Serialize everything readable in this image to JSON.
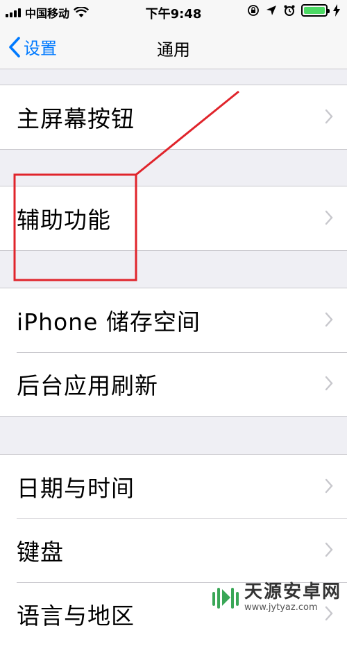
{
  "status_bar": {
    "carrier": "中国移动",
    "time": "下午9:48",
    "battery_level": 1.0,
    "icons": [
      "signal-icon",
      "wifi-icon",
      "orientation-lock-icon",
      "location-icon",
      "alarm-icon",
      "battery-icon",
      "charging-icon"
    ]
  },
  "nav": {
    "back_label": "设置",
    "title": "通用"
  },
  "groups": [
    {
      "items": [
        {
          "label": "主屏幕按钮"
        }
      ]
    },
    {
      "items": [
        {
          "label": "辅助功能"
        }
      ]
    },
    {
      "items": [
        {
          "label": "iPhone 储存空间"
        },
        {
          "label": "后台应用刷新"
        }
      ]
    },
    {
      "items": [
        {
          "label": "日期与时间"
        },
        {
          "label": "键盘"
        },
        {
          "label": "语言与地区"
        }
      ]
    }
  ],
  "colors": {
    "accent": "#007aff",
    "annotation": "#e0242b",
    "battery": "#4cd964",
    "background": "#efeff4"
  },
  "watermark": {
    "brand": "天源安卓网",
    "url": "www.jytyaz.com"
  }
}
